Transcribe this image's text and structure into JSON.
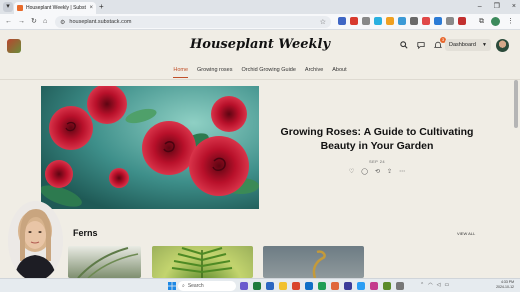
{
  "browser": {
    "tab_title": "Houseplant Weekly | Substack",
    "tab_close": "×",
    "new_tab": "+",
    "url": "houseplant.substack.com",
    "window_controls": [
      "–",
      "❐",
      "×"
    ]
  },
  "site": {
    "title": "Houseplant Weekly",
    "notification_count": "3",
    "dashboard_label": "Dashboard"
  },
  "nav": {
    "items": [
      "Home",
      "Growing roses",
      "Orchid Growing Guide",
      "Archive",
      "About"
    ],
    "active": "Home"
  },
  "featured": {
    "title": "Growing Roses: A Guide to Cultivating Beauty in Your Garden",
    "date": "SEP 24"
  },
  "section": {
    "title": "Ferns",
    "view_all": "VIEW ALL"
  },
  "taskbar": {
    "search_placeholder": "Search",
    "time": "4:33 PM",
    "date": "2024-10-12"
  },
  "colors": {
    "accent": "#c0502a",
    "page_bg": "#f0ede5",
    "rose": "#b8102a",
    "leaves": "#3e8f8a"
  },
  "icons": {
    "search": "search-icon",
    "chat": "chat-icon",
    "bell": "bell-icon",
    "like": "heart-icon",
    "comment": "comment-icon",
    "restack": "restack-icon",
    "share": "share-icon",
    "more": "more-icon"
  }
}
